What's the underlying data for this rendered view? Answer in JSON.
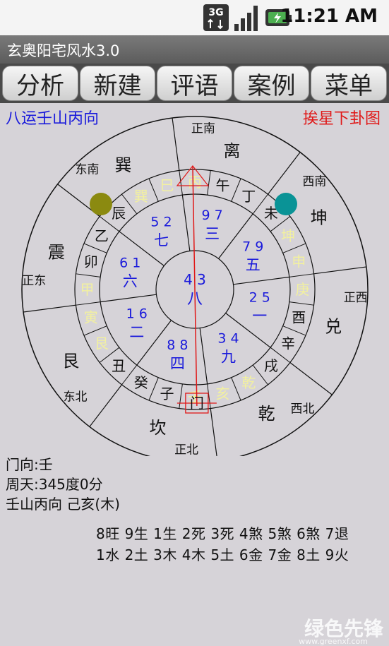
{
  "status_bar": {
    "time": "11:21 AM",
    "icons": [
      "3g-data-icon",
      "signal-strength-icon",
      "battery-charging-icon"
    ]
  },
  "app": {
    "title": "玄奥阳宅风水3.0"
  },
  "tabs": [
    {
      "label": "分析"
    },
    {
      "label": "新建"
    },
    {
      "label": "评语"
    },
    {
      "label": "案例"
    },
    {
      "label": "菜单"
    }
  ],
  "chart_header": {
    "left": "八运壬山丙向",
    "right": "挨星下卦图"
  },
  "compass": {
    "trigrams": [
      {
        "name": "离",
        "angle": 0
      },
      {
        "name": "坤",
        "angle": 45
      },
      {
        "name": "兑",
        "angle": 90
      },
      {
        "name": "乾",
        "angle": 135
      },
      {
        "name": "坎",
        "angle": 180
      },
      {
        "name": "艮",
        "angle": 225
      },
      {
        "name": "震",
        "angle": 270
      },
      {
        "name": "巽",
        "angle": 315
      }
    ],
    "directions": [
      {
        "name": "正南",
        "angle": 0
      },
      {
        "name": "西南",
        "angle": 45
      },
      {
        "name": "正西",
        "angle": 90
      },
      {
        "name": "西北",
        "angle": 135
      },
      {
        "name": "正北",
        "angle": 180
      },
      {
        "name": "东北",
        "angle": 225
      },
      {
        "name": "正东",
        "angle": 270
      },
      {
        "name": "东南",
        "angle": 315
      }
    ],
    "mountains": [
      {
        "name": "丙",
        "angle": -15,
        "highlight": true
      },
      {
        "name": "午",
        "angle": 0
      },
      {
        "name": "丁",
        "angle": 15
      },
      {
        "name": "未",
        "angle": 30
      },
      {
        "name": "坤",
        "angle": 45,
        "highlight": true
      },
      {
        "name": "申",
        "angle": 60,
        "highlight": true
      },
      {
        "name": "庚",
        "angle": 75,
        "highlight": true
      },
      {
        "name": "酉",
        "angle": 90
      },
      {
        "name": "辛",
        "angle": 105
      },
      {
        "name": "戌",
        "angle": 120
      },
      {
        "name": "乾",
        "angle": 135,
        "highlight": true
      },
      {
        "name": "亥",
        "angle": 150,
        "highlight": true
      },
      {
        "name": "壬",
        "angle": 165,
        "highlight": true
      },
      {
        "name": "子",
        "angle": 180
      },
      {
        "name": "癸",
        "angle": 195
      },
      {
        "name": "丑",
        "angle": 210
      },
      {
        "name": "艮",
        "angle": 225,
        "highlight": true
      },
      {
        "name": "寅",
        "angle": 240,
        "highlight": true
      },
      {
        "name": "甲",
        "angle": 255,
        "highlight": true
      },
      {
        "name": "卯",
        "angle": 270
      },
      {
        "name": "乙",
        "angle": 285
      },
      {
        "name": "辰",
        "angle": 300
      },
      {
        "name": "巽",
        "angle": 315,
        "highlight": true
      },
      {
        "name": "巳",
        "angle": 330,
        "highlight": true
      }
    ],
    "palaces": [
      {
        "stars": "9 7",
        "base": "三",
        "angle": 0
      },
      {
        "stars": "7 9",
        "base": "五",
        "angle": 45
      },
      {
        "stars": "2 5",
        "base": "一",
        "angle": 90
      },
      {
        "stars": "3 4",
        "base": "九",
        "angle": 135
      },
      {
        "stars": "8 8",
        "base": "四",
        "angle": 180
      },
      {
        "stars": "1 6",
        "base": "二",
        "angle": 225
      },
      {
        "stars": "6 1",
        "base": "六",
        "angle": 270
      },
      {
        "stars": "5 2",
        "base": "七",
        "angle": 315
      }
    ],
    "center": {
      "stars": "4 3",
      "base": "八"
    },
    "door_label": "门",
    "colors": {
      "mountain_highlight": "#f2f0a0",
      "stars": "#1a1adb",
      "axis": "#e01818",
      "dot_left": "#8b8a10",
      "dot_right": "#0a9396"
    }
  },
  "info": {
    "door_direction": "门向:壬",
    "degree": "周天:345度0分",
    "mountain": "壬山丙向 己亥(木)"
  },
  "legend": {
    "line1": "8旺 9生 1生 2死 3死 4煞 5煞 6煞 7退",
    "line2": "1水 2土 3木 4木 5土 6金 7金 8土 9火"
  },
  "watermark": {
    "brand": "绿色先锋",
    "url": "www.greenxf.com"
  }
}
